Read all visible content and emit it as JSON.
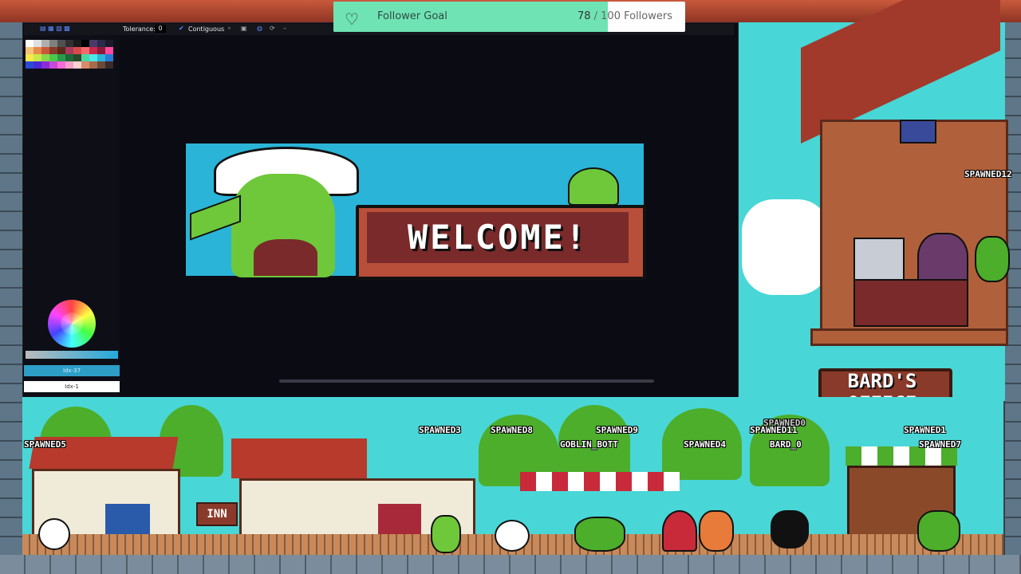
{
  "goal": {
    "title": "Follower Goal",
    "current": "78",
    "separator": " / ",
    "target": "100 Followers",
    "progress": 0.78,
    "fill_color": "#6fe3b4"
  },
  "toolbar": {
    "tolerance_label": "Tolerance:",
    "tolerance_value": "0",
    "contiguous_label": "Contiguous"
  },
  "color_panel": {
    "primary_index": "Idx-37",
    "secondary_index": "Idx-1"
  },
  "canvas": {
    "welcome_text": "WELCOME!"
  },
  "bard_sign": {
    "line1": "BARD'S",
    "line2": "OFFICE"
  },
  "inn_sign": "INN",
  "chatters": [
    "SPAWNED12",
    "SPAWNED5",
    "SPAWNED3",
    "SPAWNED8",
    "SPAWNED9",
    "SPAWNED0",
    "SPAWNED1",
    "GOBLIN_BOTT",
    "SPAWNED4",
    "SPAWNED11",
    "BARD_0",
    "SPAWNED7"
  ],
  "palette_colors": [
    "#ffffff",
    "#e0e0e0",
    "#b0b0b0",
    "#808080",
    "#505050",
    "#303030",
    "#1a1a1a",
    "#000000",
    "#4a3a6a",
    "#2a2a4a",
    "#1a1a2a",
    "#f4c27a",
    "#e88a4a",
    "#c85a3a",
    "#8a3a2a",
    "#5a2a1a",
    "#a83a5a",
    "#d84a4a",
    "#f46a6a",
    "#c8284a",
    "#8a1a3a",
    "#ff4aa0",
    "#f4e84a",
    "#c8e84a",
    "#8ad84a",
    "#4ac84a",
    "#2a9a4a",
    "#1a6a3a",
    "#2a4a2a",
    "#4ad8a0",
    "#4ae8e8",
    "#2ab4d8",
    "#2a7ad8",
    "#2a4ad8",
    "#4a2ad8",
    "#8a2ad8",
    "#c84ad8",
    "#f46ad8",
    "#f4a0c8",
    "#ffd0d0",
    "#d88a6a",
    "#a86a4a",
    "#6a4a3a",
    "#3a2a2a"
  ],
  "colors": {
    "editor_bg": "#0b0b14",
    "sky": "#49d6d6",
    "canvas_bg": "#2ab4d8"
  }
}
